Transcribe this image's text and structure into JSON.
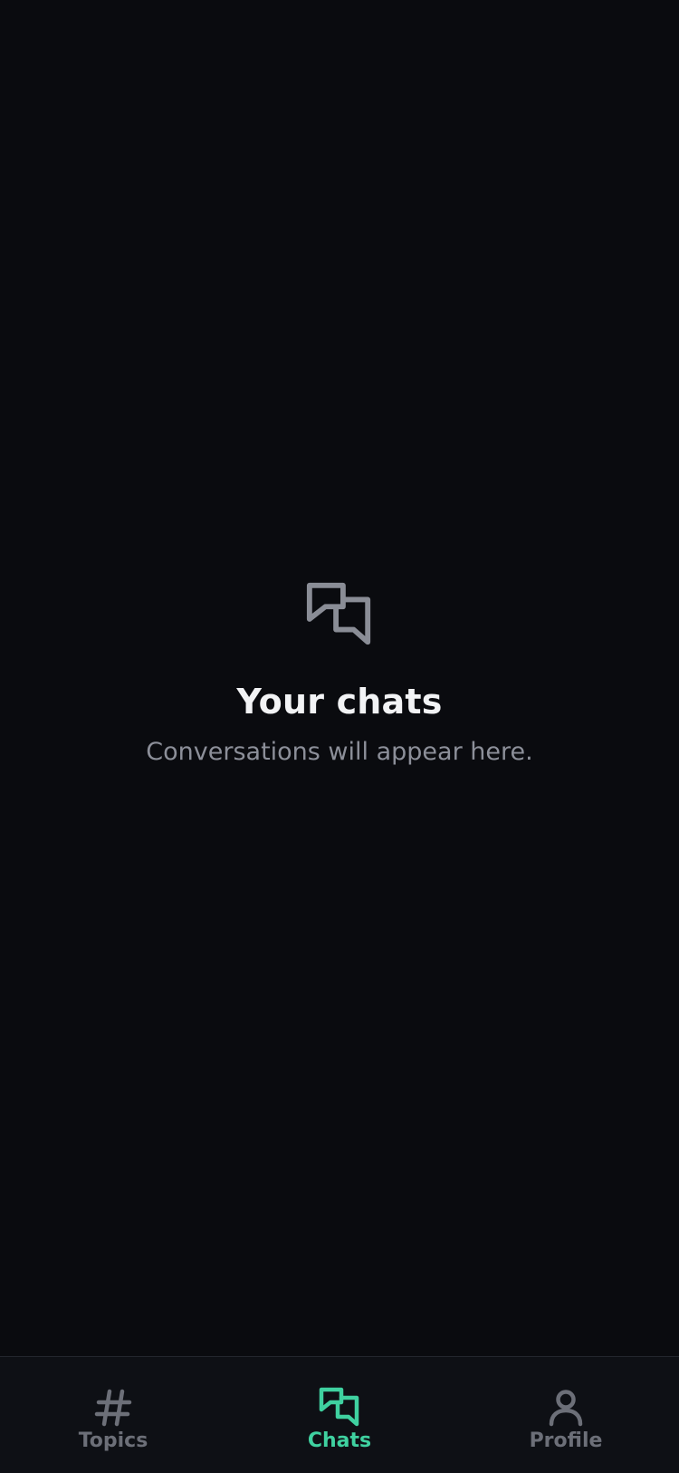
{
  "empty_state": {
    "icon": "chat-bubbles-icon",
    "title": "Your chats",
    "subtitle": "Conversations will appear here."
  },
  "tabbar": {
    "active": "Chats",
    "tabs": [
      {
        "label": "Topics",
        "icon": "hash-icon"
      },
      {
        "label": "Chats",
        "icon": "chat-bubbles-icon"
      },
      {
        "label": "Profile",
        "icon": "person-icon"
      }
    ]
  },
  "colors": {
    "background": "#0a0b0f",
    "tabbar_background": "#0e1015",
    "accent": "#3fd1a0",
    "muted": "#6c6f78",
    "icon_muted": "#8a8d96",
    "title": "#f2f3f5",
    "subtitle": "#8c8f99"
  }
}
